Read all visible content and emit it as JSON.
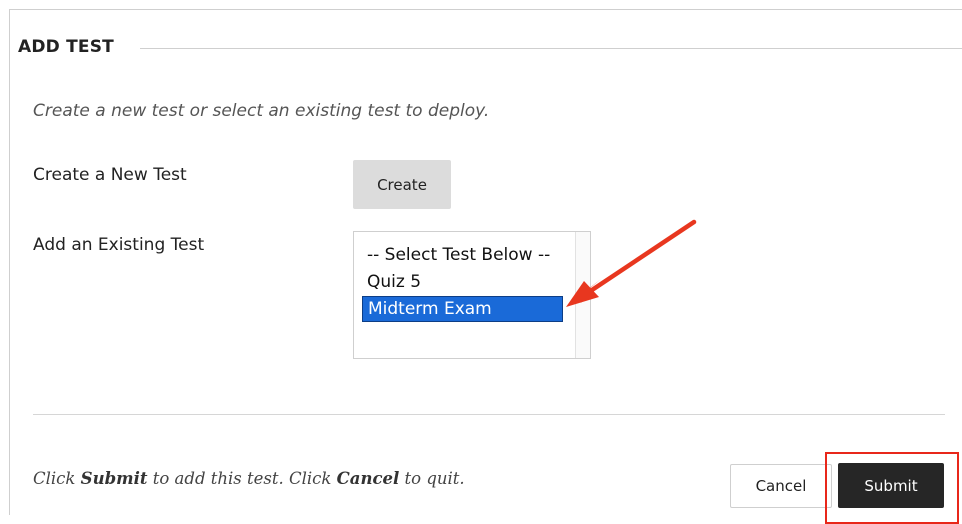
{
  "section": {
    "title": "ADD TEST"
  },
  "instructions": "Create a new test or select an existing test to deploy.",
  "create_new": {
    "label": "Create a New Test",
    "button_label": "Create"
  },
  "add_existing": {
    "label": "Add an Existing Test",
    "options": [
      "-- Select Test Below --",
      "Quiz 5",
      "Midterm Exam"
    ],
    "selected": "Midterm Exam"
  },
  "footer": {
    "text_part1": "Click ",
    "submit_word": "Submit",
    "text_part2": " to add this test. Click ",
    "cancel_word": "Cancel",
    "text_part3": " to quit.",
    "cancel_label": "Cancel",
    "submit_label": "Submit"
  },
  "annotations": {
    "arrow_color": "#e8371f",
    "highlight_color": "#e8271a"
  }
}
